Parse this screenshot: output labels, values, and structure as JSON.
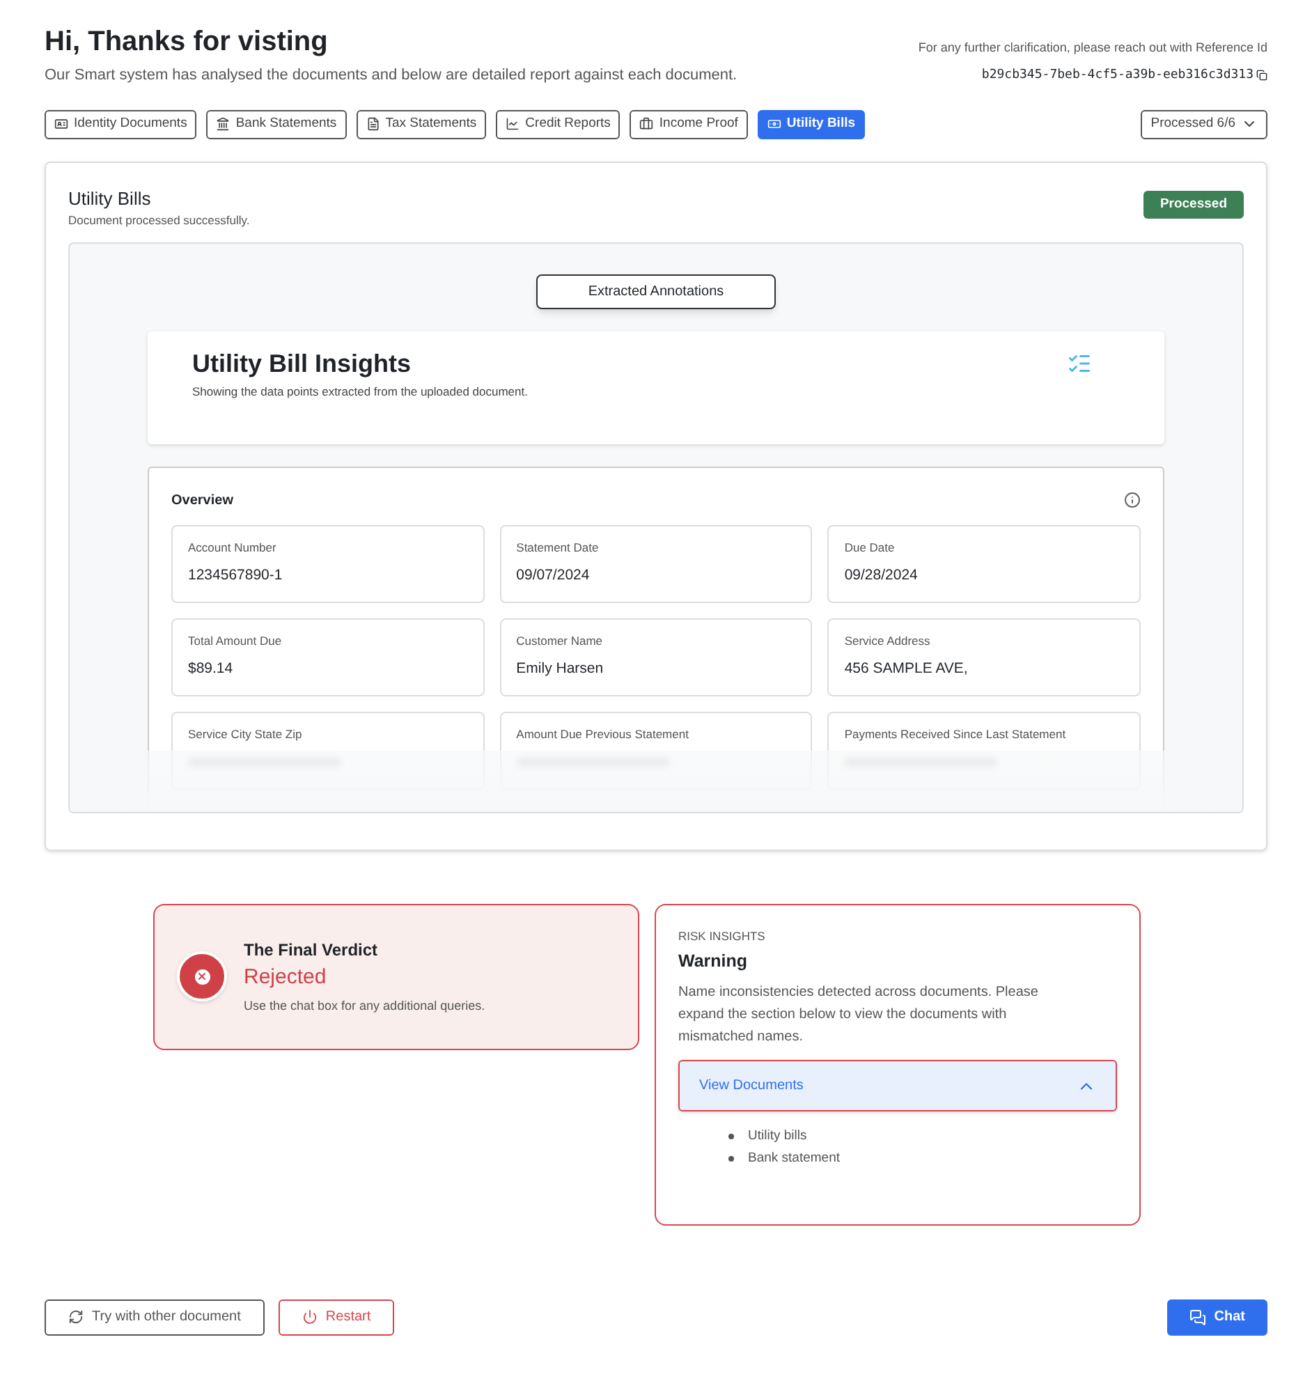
{
  "header": {
    "title": "Hi, Thanks for visting",
    "subtitle": "Our Smart system has analysed the documents and below are detailed report against each document.",
    "reference_note": "For any further clarification, please reach out with Reference Id",
    "reference_id": "b29cb345-7beb-4cf5-a39b-eeb316c3d313"
  },
  "tabs": [
    {
      "label": "Identity Documents",
      "kind": "id",
      "selected": false
    },
    {
      "label": "Bank Statements",
      "kind": "bank",
      "selected": false
    },
    {
      "label": "Tax Statements",
      "kind": "file",
      "selected": false
    },
    {
      "label": "Credit Reports",
      "kind": "chart",
      "selected": false
    },
    {
      "label": "Income Proof",
      "kind": "briefcase",
      "selected": false
    },
    {
      "label": "Utility Bills",
      "kind": "money",
      "selected": true
    }
  ],
  "progress_dropdown": {
    "label": "Processed 6/6"
  },
  "document_card": {
    "title": "Utility Bills",
    "subtitle": "Document processed successfully.",
    "status": "Processed",
    "annotations_button": "Extracted Annotations",
    "insights": {
      "title": "Utility Bill Insights",
      "subtitle": "Showing the data points extracted from the uploaded document."
    },
    "overview": {
      "title": "Overview",
      "fields": [
        {
          "label": "Account Number",
          "value": "1234567890-1",
          "kind": "value"
        },
        {
          "label": "Statement Date",
          "value": "09/07/2024",
          "kind": "value"
        },
        {
          "label": "Due Date",
          "value": "09/28/2024",
          "kind": "value"
        },
        {
          "label": "Total Amount Due",
          "value": "$89.14",
          "kind": "value"
        },
        {
          "label": "Customer Name",
          "value": "Emily Harsen",
          "kind": "value"
        },
        {
          "label": "Service Address",
          "value": "456 SAMPLE AVE,",
          "kind": "value"
        },
        {
          "label": "Service City State Zip",
          "kind": "blurred"
        },
        {
          "label": "Amount Due Previous Statement",
          "kind": "blurred"
        },
        {
          "label": "Payments Received Since Last Statement",
          "kind": "blurred"
        }
      ]
    }
  },
  "verdict": {
    "title": "The Final Verdict",
    "result": "Rejected",
    "kind": "rejected",
    "note": "Use the chat box for any additional queries."
  },
  "risk": {
    "overline": "RISK INSIGHTS",
    "title": "Warning",
    "text": "Name inconsistencies detected across documents. Please expand the section below to view the documents with mismatched names.",
    "accordion": {
      "label": "View Documents",
      "expanded": true,
      "items": [
        "Utility bills",
        "Bank statement"
      ]
    }
  },
  "footer": {
    "buttons": [
      {
        "label": "Try with other document",
        "kind": "retry"
      },
      {
        "label": "Restart",
        "kind": "restart"
      }
    ],
    "chat": "Chat"
  }
}
